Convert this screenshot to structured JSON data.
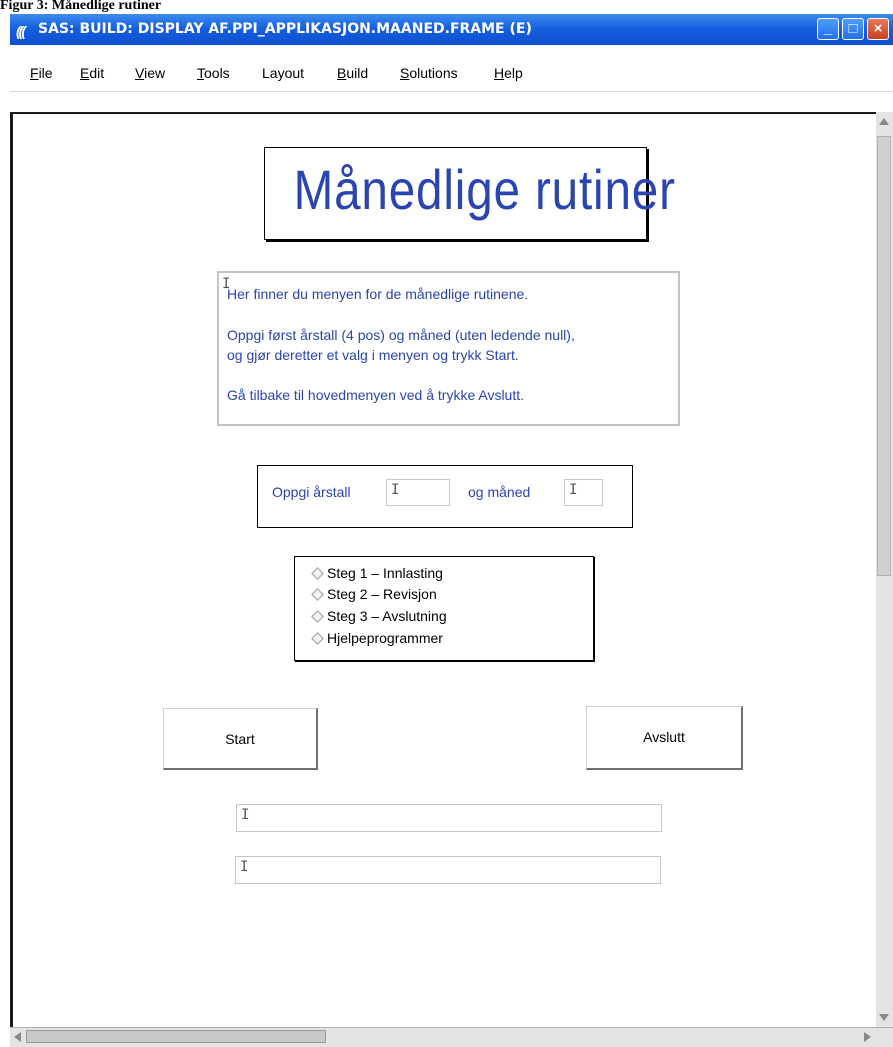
{
  "figure_caption": "Figur 3: Månedlige rutiner",
  "window": {
    "logo": "(((",
    "title": "SAS: BUILD: DISPLAY AF.PPI_APPLIKASJON.MAANED.FRAME (E)",
    "controls": {
      "minimize": "_",
      "maximize": "□",
      "close": "×"
    }
  },
  "menu": [
    {
      "underline": "F",
      "rest": "ile"
    },
    {
      "underline": "E",
      "rest": "dit"
    },
    {
      "underline": "V",
      "rest": "iew"
    },
    {
      "underline": "T",
      "rest": "ools"
    },
    {
      "underline": "",
      "rest": "Layout"
    },
    {
      "underline": "B",
      "rest": "uild"
    },
    {
      "underline": "S",
      "rest": "olutions"
    },
    {
      "underline": "H",
      "rest": "elp"
    }
  ],
  "form": {
    "heading": "Månedlige rutiner",
    "info": [
      "Her finner du menyen for de månedlige rutinene.",
      "Oppgi først årstall (4 pos) og måned (uten ledende null),",
      "og gjør deretter et valg i menyen og trykk Start.",
      "Gå tilbake til hovedmenyen ved å trykke Avslutt."
    ],
    "year_label": "Oppgi årstall",
    "year_value": "",
    "month_label": "og måned",
    "month_value": "",
    "steps": [
      "Steg 1 – Innlasting",
      "Steg 2 – Revisjon",
      "Steg 3 – Avslutning",
      "Hjelpeprogrammer"
    ],
    "start_label": "Start",
    "exit_label": "Avslutt",
    "output1_value": "",
    "output2_value": ""
  },
  "icons": {
    "caret": "I",
    "radio": "diamond-radio"
  },
  "colors": {
    "title_bar": "#1660e0",
    "form_text": "#2a45b0"
  }
}
